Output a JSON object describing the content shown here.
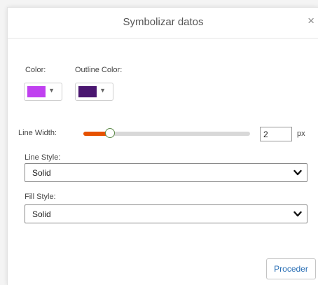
{
  "dialog": {
    "title": "Symbolizar datos",
    "close_glyph": "×"
  },
  "color": {
    "label": "Color:",
    "value": "#c040f0",
    "caret": "▼"
  },
  "outline_color": {
    "label": "Outline Color:",
    "value": "#4a1670",
    "caret": "▼"
  },
  "line_width": {
    "label": "Line Width:",
    "value": "2",
    "unit": "px",
    "slider_fraction": 0.16,
    "accent": "#e65100"
  },
  "line_style": {
    "label": "Line Style:",
    "selected": "Solid"
  },
  "fill_style": {
    "label": "Fill Style:",
    "selected": "Solid"
  },
  "actions": {
    "proceed_label": "Proceder"
  },
  "icons": {
    "close": "close-icon",
    "dropdown": "chevron-down-icon",
    "caret": "caret-down-icon"
  }
}
